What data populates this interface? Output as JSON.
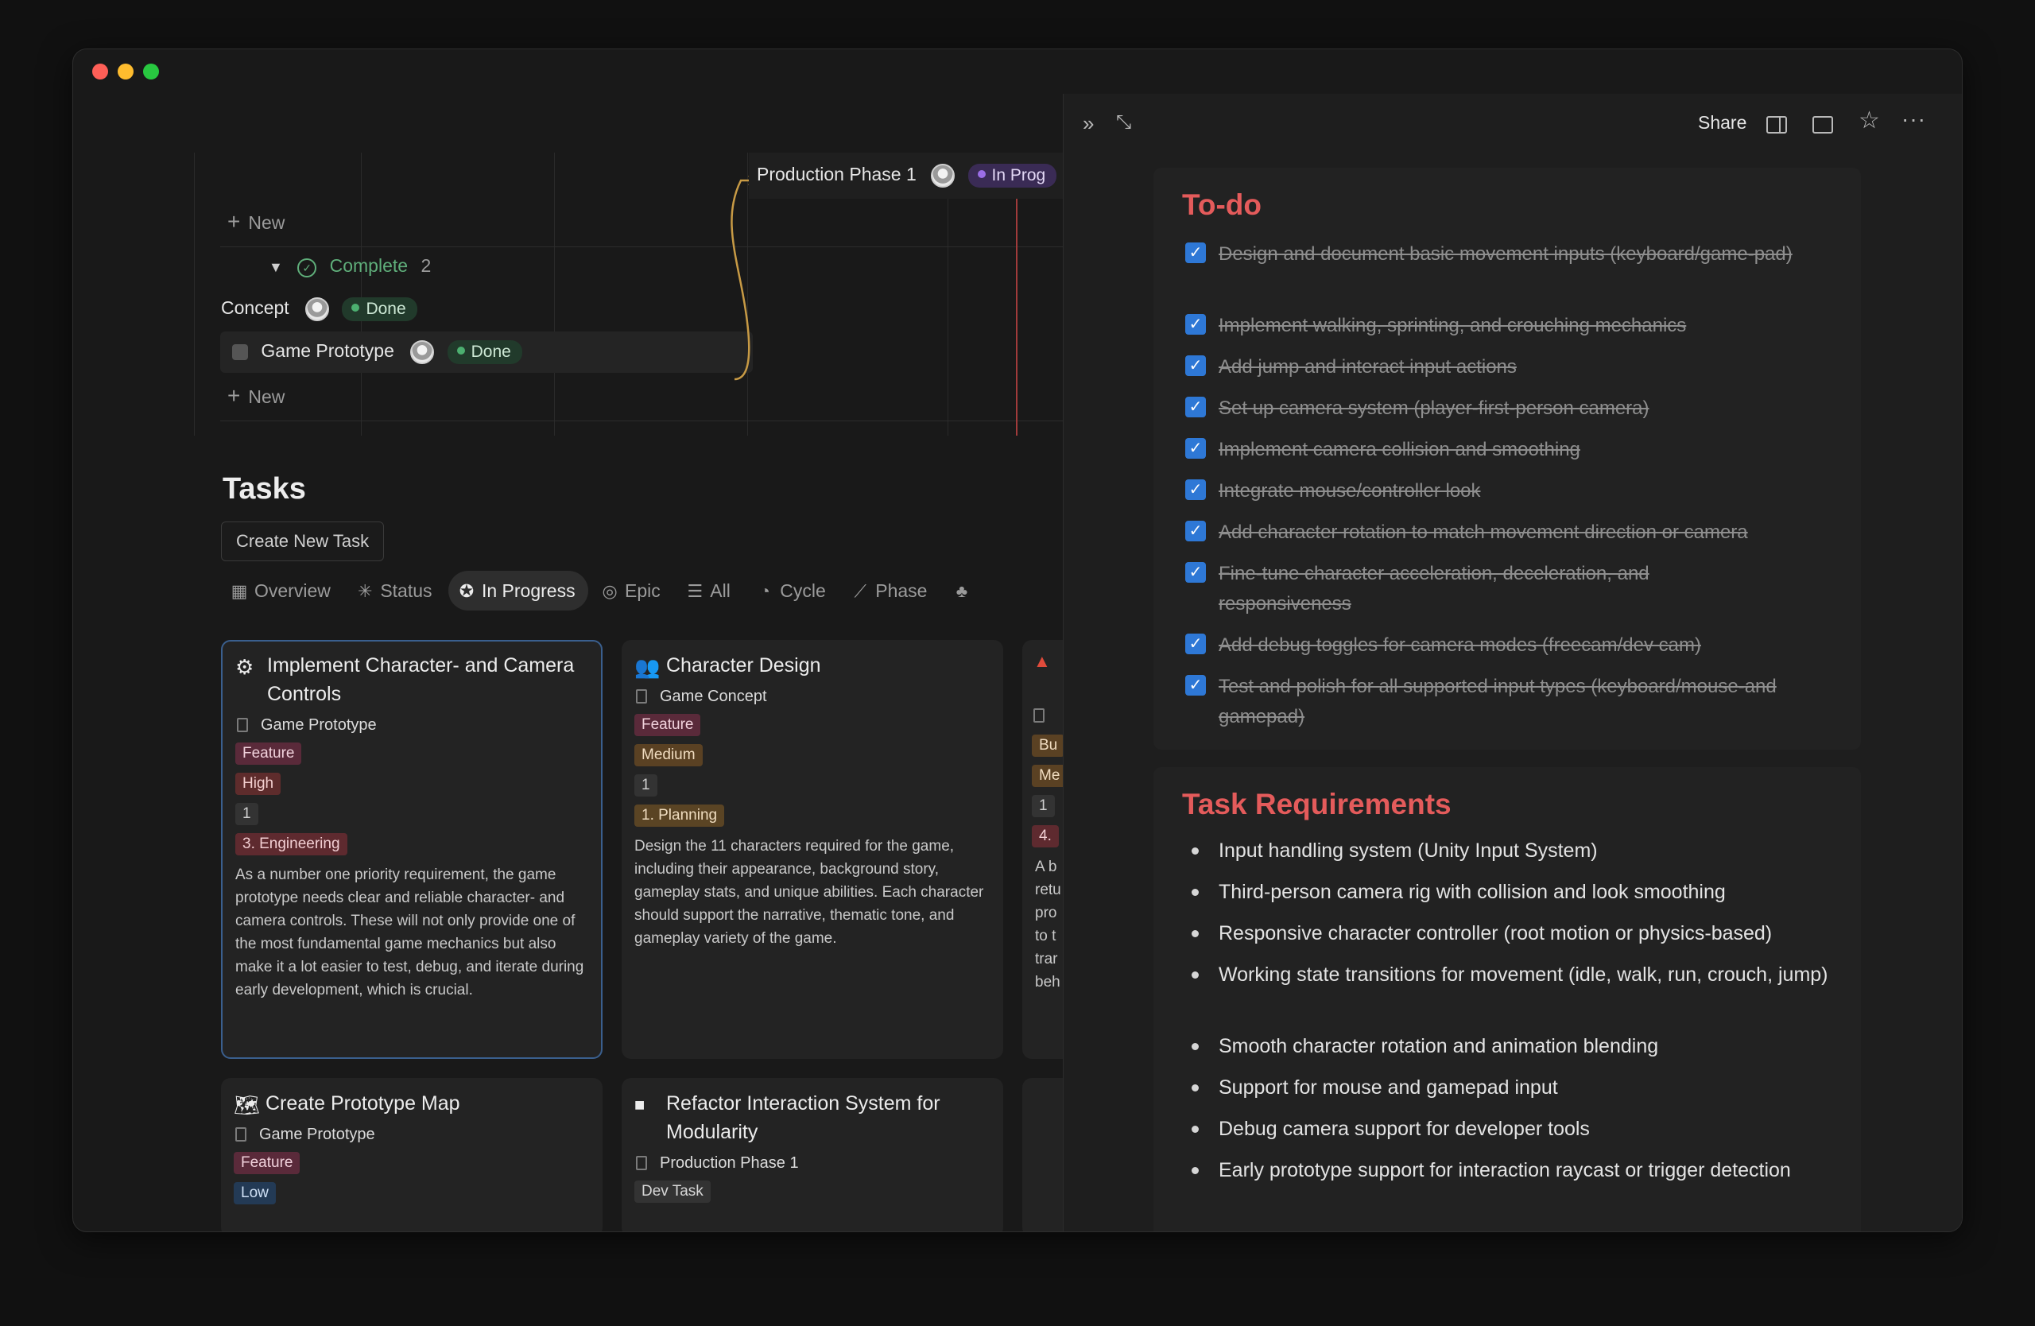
{
  "timeline": {
    "new_label_1": "New",
    "group_label": "Complete",
    "group_count": "2",
    "rows": [
      {
        "name": "Concept",
        "status": "Done"
      },
      {
        "name": "Game Prototype",
        "status": "Done"
      }
    ],
    "new_label_2": "New",
    "phase": {
      "name": "Production Phase 1",
      "status": "In Prog"
    }
  },
  "tasks": {
    "title": "Tasks",
    "create_button": "Create New Task",
    "tabs": [
      {
        "label": "Overview",
        "icon": "grid-icon"
      },
      {
        "label": "Status",
        "icon": "sparkle-icon"
      },
      {
        "label": "In Progress",
        "icon": "star-circle-icon"
      },
      {
        "label": "Epic",
        "icon": "target-icon"
      },
      {
        "label": "All",
        "icon": "list-icon"
      },
      {
        "label": "Cycle",
        "icon": "cycle-icon"
      },
      {
        "label": "Phase",
        "icon": "phase-icon"
      }
    ],
    "cards": [
      {
        "title": "Implement Character- and Camera Controls",
        "icon": "gear-icon",
        "parent": "Game Prototype",
        "tags": [
          "Feature",
          "High",
          "1",
          "3. Engineering"
        ],
        "description": "As a number one priority requirement, the game prototype needs clear and reliable character- and camera controls. These will not only provide one of the most fundamental game mechanics but also make it a lot easier to test, debug, and iterate during early development, which is crucial."
      },
      {
        "title": "Character Design",
        "icon": "people-icon",
        "parent": "Game Concept",
        "tags": [
          "Feature",
          "Medium",
          "1",
          "1. Planning"
        ],
        "description": "Design the 11 characters required for the game, including their appearance, background story, gameplay stats, and unique abilities. Each character should support the narrative, thematic tone, and gameplay variety of the game."
      },
      {
        "title": "",
        "icon": "warning-icon",
        "parent": "",
        "tags": [
          "Bu",
          "Me",
          "1",
          "4."
        ],
        "description_lines": [
          "A b",
          "retu",
          "pro",
          "to t",
          "trar",
          "beh"
        ]
      },
      {
        "title": "Create Prototype Map",
        "icon": "map-icon",
        "parent": "Game Prototype",
        "tags": [
          "Feature",
          "Low"
        ]
      },
      {
        "title": "Refactor Interaction System for Modularity",
        "icon": "square-icon",
        "parent": "Production Phase 1",
        "tags": [
          "Dev Task"
        ]
      }
    ]
  },
  "panel": {
    "share_label": "Share",
    "todo_title": "To-do",
    "todos": [
      "Design and document basic movement inputs (keyboard/game-pad)",
      "Implement walking, sprinting, and crouching mechanics",
      "Add jump and interact input actions",
      "Set up camera system (player-first-person camera)",
      "Implement camera collision and smoothing",
      "Integrate mouse/controller look",
      "Add character rotation to match movement direction or camera",
      "Fine-tune character acceleration, deceleration, and responsiveness",
      "Add debug toggles for camera modes (freecam/dev cam)",
      "Test and polish for all supported input types (keyboard/mouse-and gamepad)"
    ],
    "req_title": "Task Requirements",
    "requirements": [
      "Input handling system (Unity Input System)",
      "Third-person camera rig with collision and look smoothing",
      "Responsive character controller (root motion or physics-based)",
      "Working state transitions for movement (idle, walk, run, crouch, jump)",
      "Smooth character rotation and animation blending",
      "Support for mouse and gamepad input",
      "Debug camera support for developer tools",
      "Early prototype support for interaction raycast or trigger detection"
    ]
  }
}
